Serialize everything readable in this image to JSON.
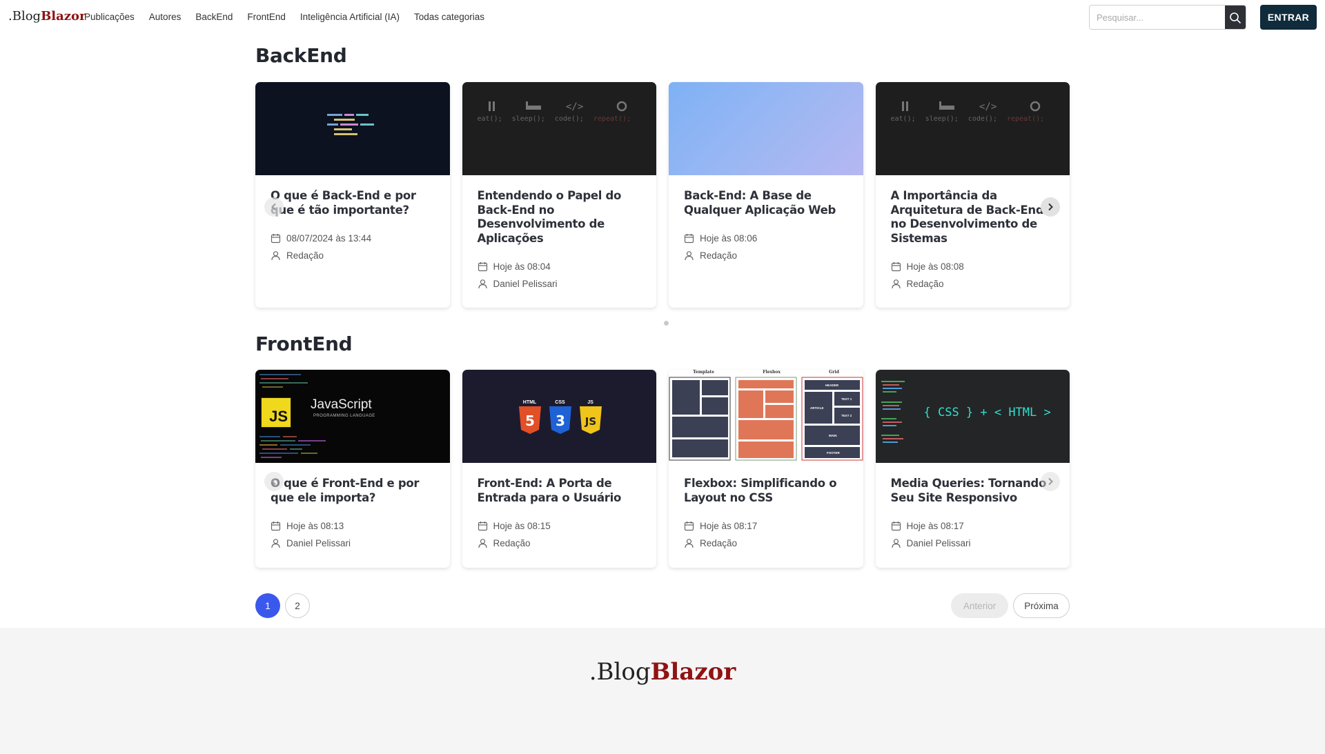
{
  "header": {
    "logo_prefix": ".Blog",
    "logo_brand": "Blazor",
    "nav": [
      "Publicações",
      "Autores",
      "BackEnd",
      "FrontEnd",
      "Inteligência Artificial (IA)",
      "Todas categorias"
    ],
    "search_placeholder": "Pesquisar...",
    "login_label": "ENTRAR"
  },
  "sections": [
    {
      "title": "BackEnd",
      "cards": [
        {
          "title": "O que é Back-End e por que é tão importante?",
          "date": "08/07/2024 às 13:44",
          "author": "Redação",
          "thumb": "code-snippet"
        },
        {
          "title": "Entendendo o Papel do Back-End no Desenvolvimento de Aplicações",
          "date": "Hoje às 08:04",
          "author": "Daniel Pelissari",
          "thumb": "eat-sleep-code-repeat"
        },
        {
          "title": "Back-End: A Base de Qualquer Aplicação Web",
          "date": "Hoje às 08:06",
          "author": "Redação",
          "thumb": "blue-gradient"
        },
        {
          "title": "A Importância da Arquitetura de Back-End no Desenvolvimento de Sistemas",
          "date": "Hoje às 08:08",
          "author": "Redação",
          "thumb": "eat-sleep-code-repeat"
        }
      ]
    },
    {
      "title": "FrontEnd",
      "cards": [
        {
          "title": "O que é Front-End e por que ele importa?",
          "date": "Hoje às 08:13",
          "author": "Daniel Pelissari",
          "thumb": "javascript"
        },
        {
          "title": "Front-End: A Porta de Entrada para o Usuário",
          "date": "Hoje às 08:15",
          "author": "Redação",
          "thumb": "html-css-js"
        },
        {
          "title": "Flexbox: Simplificando o Layout no CSS",
          "date": "Hoje às 08:17",
          "author": "Redação",
          "thumb": "template-flexbox-grid"
        },
        {
          "title": "Media Queries: Tornando Seu Site Responsivo",
          "date": "Hoje às 08:17",
          "author": "Daniel Pelissari",
          "thumb": "css-html-code"
        }
      ]
    }
  ],
  "thumb_text": {
    "esc": [
      "eat();",
      "sleep();",
      "code();",
      "repeat();"
    ],
    "js_badge": "JS",
    "js_title": "JavaScript",
    "js_sub": "PROGRAMMING LANGUAGE",
    "html": "HTML",
    "css": "CSS",
    "js": "JS",
    "layout": [
      "Template",
      "Flexbox",
      "Grid"
    ],
    "grid_labels": [
      "HEADER",
      "TEXT 1",
      "ARTICLE",
      "TEXT 2",
      "MAIN",
      "FOOTER"
    ],
    "css_html": "{ CSS } + < HTML >"
  },
  "pagination": {
    "pages": [
      "1",
      "2"
    ],
    "current": "1",
    "prev_label": "Anterior",
    "next_label": "Próxima"
  },
  "footer": {
    "logo_prefix": ".Blog",
    "logo_brand": "Blazor"
  },
  "colors": {
    "brand": "#8f1313",
    "login_bg": "#0f2b3c",
    "active_page": "#3a59ec",
    "footer_bg": "#f5f5f5"
  }
}
